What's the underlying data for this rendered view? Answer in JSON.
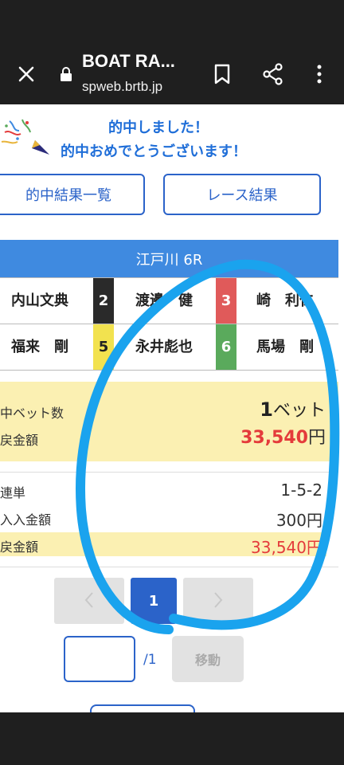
{
  "browser": {
    "site_title": "BOAT RA...",
    "site_url": "spweb.brtb.jp"
  },
  "banner": {
    "line1": "的中しました！",
    "line2": "的中おめでとうございます！"
  },
  "buttons": {
    "results_list": "的中結果一覧",
    "race_results": "レース結果"
  },
  "race": {
    "header": "江戸川 6R",
    "racers": [
      {
        "name": "内山文典",
        "lane": "2"
      },
      {
        "name": "渡邊　健",
        "lane": "3"
      },
      {
        "name": "崎　利仁",
        "lane": ""
      },
      {
        "name": "福来　剛",
        "lane": "5"
      },
      {
        "name": "永井彪也",
        "lane": "6"
      },
      {
        "name": "馬場　剛",
        "lane": ""
      }
    ]
  },
  "summary": {
    "bets_label": "中ベット数",
    "bets_count": "1",
    "bets_unit": "ベット",
    "payout_label": "戻金額",
    "payout_amount": "33,540",
    "payout_unit": "円"
  },
  "detail": {
    "type_label": "連単",
    "type_value": "1-5-2",
    "purchase_label": "入入金額",
    "purchase_value": "300円",
    "refund_label": "戻金額",
    "refund_value": "33,540円"
  },
  "pagination": {
    "current": "1",
    "total": "/1",
    "move_label": "移動"
  },
  "colors": {
    "accent": "#2b63c9",
    "header_blue": "#3f8ae0",
    "highlight_yellow": "#fbf0b2",
    "amount_red": "#e43b3b",
    "annotation_cyan": "#1aa3ee"
  }
}
